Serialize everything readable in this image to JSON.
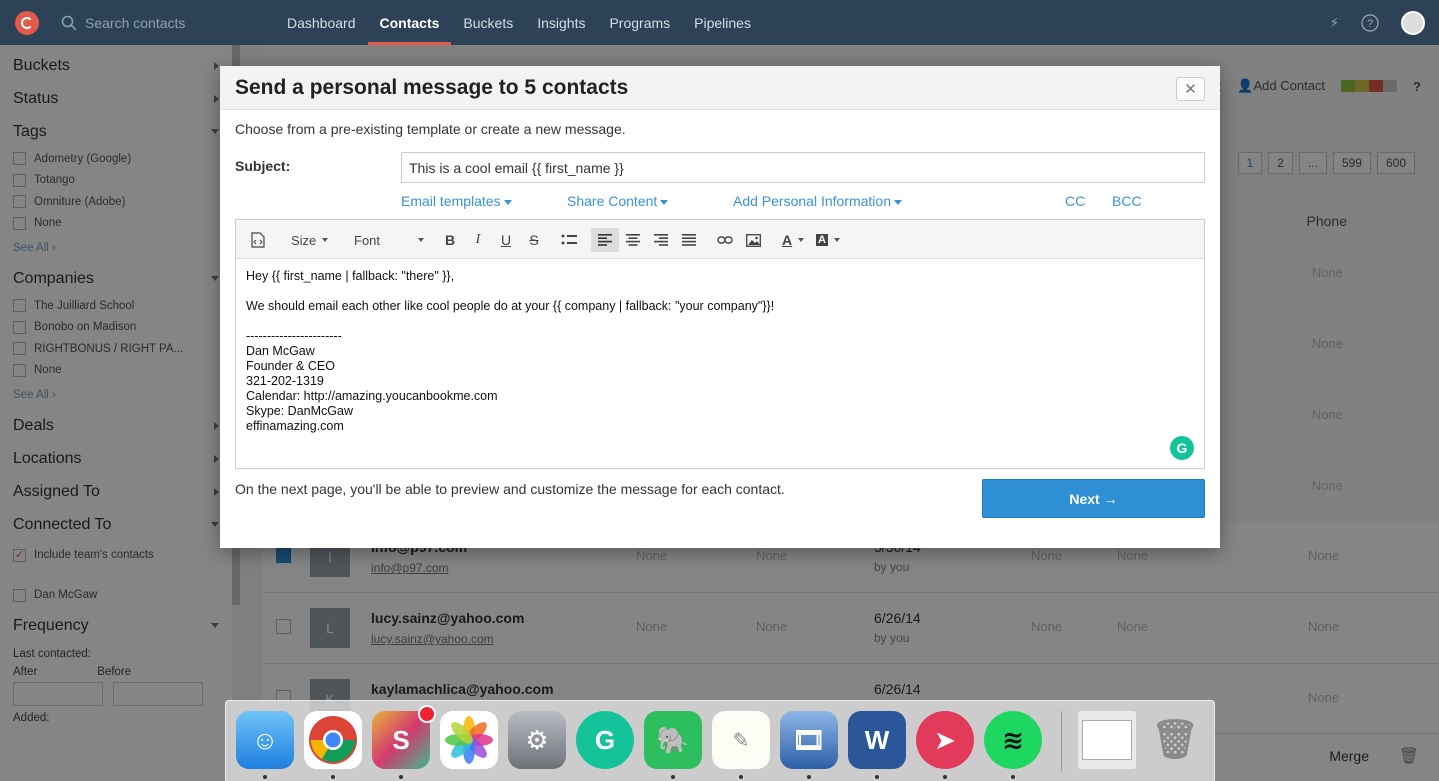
{
  "nav": {
    "search_placeholder": "Search contacts",
    "links": [
      "Dashboard",
      "Contacts",
      "Buckets",
      "Insights",
      "Programs",
      "Pipelines"
    ],
    "active": "Contacts"
  },
  "sidebar": {
    "buckets": "Buckets",
    "status": "Status",
    "tags": "Tags",
    "tag_options": [
      "Adometry (Google)",
      "Totango",
      "Omniture (Adobe)",
      "None"
    ],
    "see_all": "See All ›",
    "companies": "Companies",
    "company_options": [
      "The Juilliard School",
      "Bonobo on Madison",
      "RIGHTBONUS / RIGHT PA...",
      "None"
    ],
    "deals": "Deals",
    "locations": "Locations",
    "assigned_to": "Assigned To",
    "connected_to": "Connected To",
    "include_team": "Include team's contacts",
    "dan": "Dan McGaw",
    "frequency": "Frequency",
    "last_contacted": "Last contacted:",
    "after": "After",
    "before": "Before",
    "added": "Added:"
  },
  "main": {
    "toolbar_rt": "rt",
    "add_contact": "Add Contact",
    "pager": [
      "1",
      "2",
      "...",
      "599",
      "600"
    ],
    "phone_header": "Phone",
    "none": "None",
    "rows": [
      {
        "initial": "I",
        "email": "info@p97.com",
        "email2": "info@p97.com",
        "date": "5/30/14",
        "by": "by you"
      },
      {
        "initial": "L",
        "email": "lucy.sainz@yahoo.com",
        "email2": "lucy.sainz@yahoo.com",
        "date": "6/26/14",
        "by": "by you"
      },
      {
        "initial": "K",
        "email": "kaylamachlica@yahoo.com",
        "email2": "",
        "date": "6/26/14",
        "by": ""
      }
    ],
    "merge": "Merge"
  },
  "modal": {
    "title": "Send a personal message to 5 contacts",
    "close": "✕",
    "intro": "Choose from a pre-existing template or create a new message.",
    "subject_label": "Subject:",
    "subject_value": "This is a cool email  {{ first_name }}",
    "email_templates": "Email templates",
    "share_content": "Share Content",
    "add_personal": "Add Personal Information",
    "cc": "CC",
    "bcc": "BCC",
    "toolbar": {
      "size": "Size",
      "font": "Font"
    },
    "body": {
      "greeting": "Hey {{ first_name | fallback: \"there\" }},",
      "line": "We should email each other like cool people do at your {{ company | fallback: \"your company\"}}!",
      "sep": "-----------------------",
      "sig": [
        "Dan McGaw",
        "Founder & CEO",
        "321-202-1319",
        "Calendar: http://amazing.youcanbookme.com",
        "Skype: DanMcGaw",
        "effinamazing.com"
      ]
    },
    "footnote": "On the next page, you'll be able to preview and customize the message for each contact.",
    "next": "Next →"
  },
  "dock": [
    "Finder",
    "Chrome",
    "Slack",
    "Photos",
    "System Preferences",
    "Grammarly",
    "Evernote",
    "TextEdit",
    "Screen Recorder",
    "Word",
    "Skitch",
    "Spotify",
    "Finder Window",
    "Trash"
  ],
  "colors": {
    "nav": "#2d4256",
    "accent": "#e25a4a",
    "link": "#3a93d5",
    "button": "#2e8fd4"
  }
}
